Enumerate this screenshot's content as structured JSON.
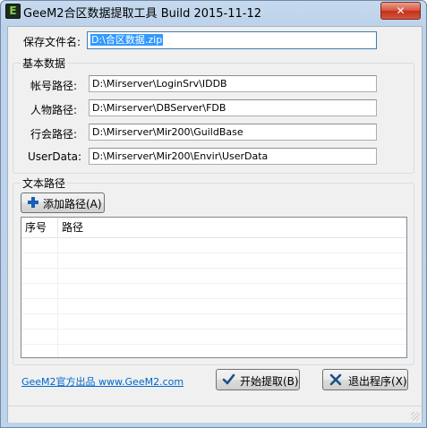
{
  "window": {
    "title": "GeeM2合区数据提取工具 Build 2015-11-12",
    "icon_letter": "E",
    "close_label": "✕"
  },
  "save_file": {
    "label": "保存文件名:",
    "value": "D:\\合区数据.zip"
  },
  "basic_data": {
    "group_title": "基本数据",
    "fields": [
      {
        "label": "帐号路径:",
        "value": "D:\\Mirserver\\LoginSrv\\IDDB"
      },
      {
        "label": "人物路径:",
        "value": "D:\\Mirserver\\DBServer\\FDB"
      },
      {
        "label": "行会路径:",
        "value": "D:\\Mirserver\\Mir200\\GuildBase"
      },
      {
        "label": "UserData:",
        "value": "D:\\Mirserver\\Mir200\\Envir\\UserData"
      }
    ]
  },
  "text_paths": {
    "group_title": "文本路径",
    "add_button": "添加路径(A)",
    "add_icon": "plus-icon",
    "columns": [
      "序号",
      "路径"
    ],
    "rows": []
  },
  "footer": {
    "link": "GeeM2官方出品 www.GeeM2.com",
    "start_button": "开始提取(B)",
    "start_icon": "check-icon",
    "exit_button": "退出程序(X)",
    "exit_icon": "x-icon"
  },
  "colors": {
    "accent_blue": "#1a5fb4",
    "selection": "#3399ff",
    "link": "#0066cc"
  }
}
